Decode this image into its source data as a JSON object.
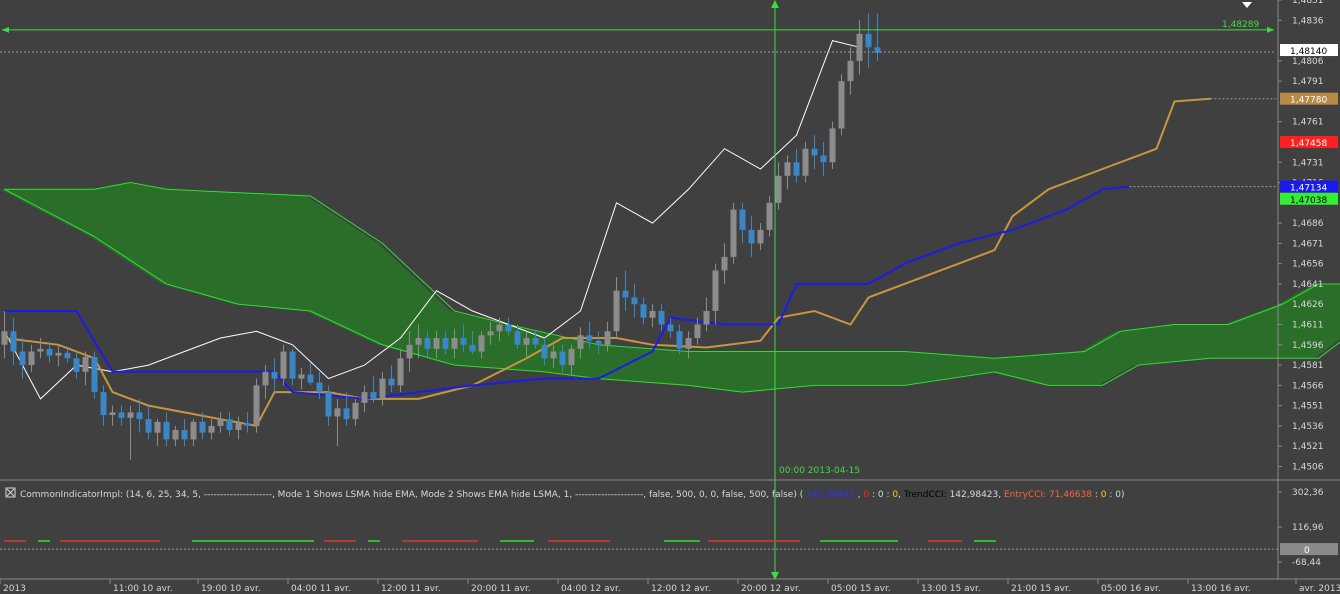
{
  "colors": {
    "background": "#404040",
    "axis_text": "#d8d8d8",
    "bull_candle": "#8c8c8c",
    "bear_candle": "#3a86c6",
    "tenkan": "#c8963e",
    "kijun": "#1b1bea",
    "chikou": "#ffffff",
    "cloud_bear_fill": "#6e2a26",
    "cloud_bear_edge": "#d23a2f",
    "cloud_bull_fill": "#2a6e2a",
    "cloud_bull_edge": "#2ee02e",
    "crosshair": "#3ddc3d",
    "separator": "#8a8a8a"
  },
  "chart_data": {
    "type": "candlestick",
    "title": "",
    "ylim": [
      1.4496,
      1.4851
    ],
    "y_ticks": [
      "1,4851",
      "1,4836",
      "1,4806",
      "1,4791",
      "1,4761",
      "1,4731",
      "1,4716",
      "1,4686",
      "1,4671",
      "1,4656",
      "1,4641",
      "1,4626",
      "1,4611",
      "1,4596",
      "1,4581",
      "1,4566",
      "1,4551",
      "1,4536",
      "1,4521",
      "1,4506"
    ],
    "x_tick_labels": [
      "2013",
      "11:00 10 avr.",
      "19:00 10 avr.",
      "04:00 11 avr.",
      "12:00 11 avr.",
      "20:00 11 avr.",
      "04:00 12 avr.",
      "12:00 12 avr.",
      "20:00 12 avr.",
      "05:00 15 avr.",
      "13:00 15 avr.",
      "21:00 15 avr.",
      "05:00 16 avr.",
      "13:00 16 avr.",
      "avr. 2013"
    ],
    "n_slots": 142,
    "candles": [
      [
        1.4596,
        1.4621,
        1.4586,
        1.4606
      ],
      [
        1.4606,
        1.4616,
        1.4581,
        1.4591
      ],
      [
        1.4591,
        1.4601,
        1.4571,
        1.4581
      ],
      [
        1.4581,
        1.4596,
        1.4576,
        1.4591
      ],
      [
        1.4591,
        1.4601,
        1.4586,
        1.4593
      ],
      [
        1.4593,
        1.4598,
        1.4583,
        1.4588
      ],
      [
        1.4588,
        1.4596,
        1.458,
        1.459
      ],
      [
        1.459,
        1.4593,
        1.4583,
        1.4586
      ],
      [
        1.4586,
        1.4591,
        1.4571,
        1.4576
      ],
      [
        1.4576,
        1.4591,
        1.4566,
        1.4587
      ],
      [
        1.4587,
        1.4591,
        1.4556,
        1.4561
      ],
      [
        1.4561,
        1.4566,
        1.4536,
        1.4544
      ],
      [
        1.4544,
        1.4551,
        1.4536,
        1.4546
      ],
      [
        1.4546,
        1.4551,
        1.4536,
        1.4542
      ],
      [
        1.4542,
        1.4551,
        1.4511,
        1.4546
      ],
      [
        1.4546,
        1.4556,
        1.4531,
        1.4541
      ],
      [
        1.4541,
        1.4551,
        1.4526,
        1.4531
      ],
      [
        1.4531,
        1.4541,
        1.4521,
        1.4539
      ],
      [
        1.4539,
        1.4546,
        1.4521,
        1.4526
      ],
      [
        1.4526,
        1.4536,
        1.4521,
        1.4533
      ],
      [
        1.4533,
        1.4541,
        1.4521,
        1.4526
      ],
      [
        1.4526,
        1.4541,
        1.4521,
        1.4539
      ],
      [
        1.4539,
        1.4546,
        1.4526,
        1.4531
      ],
      [
        1.4531,
        1.4541,
        1.4526,
        1.4536
      ],
      [
        1.4536,
        1.4546,
        1.4531,
        1.4541
      ],
      [
        1.4541,
        1.4546,
        1.4529,
        1.4533
      ],
      [
        1.4533,
        1.4543,
        1.4526,
        1.4538
      ],
      [
        1.4538,
        1.4546,
        1.4531,
        1.4536
      ],
      [
        1.4536,
        1.4571,
        1.4531,
        1.4566
      ],
      [
        1.4566,
        1.4581,
        1.4556,
        1.4576
      ],
      [
        1.4576,
        1.4586,
        1.4561,
        1.4571
      ],
      [
        1.4571,
        1.4596,
        1.4566,
        1.4591
      ],
      [
        1.4591,
        1.4593,
        1.4566,
        1.4571
      ],
      [
        1.4571,
        1.4579,
        1.4563,
        1.4574
      ],
      [
        1.4574,
        1.4583,
        1.4566,
        1.4568
      ],
      [
        1.4568,
        1.4576,
        1.4556,
        1.4561
      ],
      [
        1.4561,
        1.4566,
        1.4536,
        1.4543
      ],
      [
        1.4543,
        1.4556,
        1.4521,
        1.4549
      ],
      [
        1.4549,
        1.4561,
        1.4536,
        1.4541
      ],
      [
        1.4541,
        1.4556,
        1.4536,
        1.4553
      ],
      [
        1.4553,
        1.4566,
        1.4546,
        1.4561
      ],
      [
        1.4561,
        1.4573,
        1.4553,
        1.4556
      ],
      [
        1.4556,
        1.4576,
        1.4551,
        1.4571
      ],
      [
        1.4571,
        1.4581,
        1.4561,
        1.4566
      ],
      [
        1.4566,
        1.4593,
        1.4561,
        1.4586
      ],
      [
        1.4586,
        1.4606,
        1.4576,
        1.4596
      ],
      [
        1.4596,
        1.4611,
        1.4586,
        1.4601
      ],
      [
        1.4601,
        1.4606,
        1.4586,
        1.4593
      ],
      [
        1.4593,
        1.4606,
        1.4586,
        1.4601
      ],
      [
        1.4601,
        1.4606,
        1.4589,
        1.4593
      ],
      [
        1.4593,
        1.4608,
        1.4586,
        1.4601
      ],
      [
        1.4601,
        1.4611,
        1.4591,
        1.4596
      ],
      [
        1.4596,
        1.4606,
        1.4589,
        1.4591
      ],
      [
        1.4591,
        1.4606,
        1.4586,
        1.4603
      ],
      [
        1.4603,
        1.4613,
        1.4596,
        1.4606
      ],
      [
        1.4606,
        1.4616,
        1.4599,
        1.4611
      ],
      [
        1.4611,
        1.4616,
        1.4603,
        1.4606
      ],
      [
        1.4606,
        1.4611,
        1.4593,
        1.4596
      ],
      [
        1.4596,
        1.4606,
        1.4586,
        1.4601
      ],
      [
        1.4601,
        1.4606,
        1.4593,
        1.4596
      ],
      [
        1.4596,
        1.4601,
        1.4581,
        1.4586
      ],
      [
        1.4586,
        1.4596,
        1.4579,
        1.4591
      ],
      [
        1.4591,
        1.4596,
        1.4576,
        1.4581
      ],
      [
        1.4581,
        1.4596,
        1.4573,
        1.4593
      ],
      [
        1.4593,
        1.4609,
        1.4586,
        1.4603
      ],
      [
        1.4603,
        1.4613,
        1.4593,
        1.4599
      ],
      [
        1.4599,
        1.4606,
        1.4589,
        1.4596
      ],
      [
        1.4596,
        1.4613,
        1.4591,
        1.4606
      ],
      [
        1.4606,
        1.4646,
        1.4601,
        1.4636
      ],
      [
        1.4636,
        1.4651,
        1.4621,
        1.4631
      ],
      [
        1.4631,
        1.4641,
        1.4616,
        1.4626
      ],
      [
        1.4626,
        1.4631,
        1.4611,
        1.4616
      ],
      [
        1.4616,
        1.4626,
        1.4609,
        1.4621
      ],
      [
        1.4621,
        1.4626,
        1.4606,
        1.4611
      ],
      [
        1.4611,
        1.4616,
        1.4601,
        1.4606
      ],
      [
        1.4606,
        1.4611,
        1.4589,
        1.4593
      ],
      [
        1.4593,
        1.4606,
        1.4586,
        1.4601
      ],
      [
        1.4601,
        1.4616,
        1.4596,
        1.4611
      ],
      [
        1.4611,
        1.4631,
        1.4606,
        1.4621
      ],
      [
        1.4621,
        1.4656,
        1.4611,
        1.4651
      ],
      [
        1.4651,
        1.4671,
        1.4641,
        1.4661
      ],
      [
        1.4661,
        1.4701,
        1.4656,
        1.4696
      ],
      [
        1.4696,
        1.4701,
        1.4671,
        1.4681
      ],
      [
        1.4681,
        1.4691,
        1.4661,
        1.4671
      ],
      [
        1.4671,
        1.4686,
        1.4666,
        1.4681
      ],
      [
        1.4681,
        1.4706,
        1.4676,
        1.4701
      ],
      [
        1.4701,
        1.4731,
        1.4696,
        1.4721
      ],
      [
        1.4721,
        1.4736,
        1.4711,
        1.4731
      ],
      [
        1.4731,
        1.4741,
        1.4716,
        1.4721
      ],
      [
        1.4721,
        1.4746,
        1.4716,
        1.4741
      ],
      [
        1.4741,
        1.4751,
        1.4726,
        1.4736
      ],
      [
        1.4736,
        1.4746,
        1.4721,
        1.4731
      ],
      [
        1.4731,
        1.4761,
        1.4726,
        1.4756
      ],
      [
        1.4756,
        1.4796,
        1.4751,
        1.4791
      ],
      [
        1.4791,
        1.4816,
        1.4781,
        1.4806
      ],
      [
        1.4806,
        1.4836,
        1.4796,
        1.4826
      ],
      [
        1.4826,
        1.4841,
        1.4801,
        1.4816
      ],
      [
        1.4816,
        1.4841,
        1.4806,
        1.4812
      ]
    ],
    "tenkan_sen": [
      [
        0,
        1.4601
      ],
      [
        6,
        1.4596
      ],
      [
        10,
        1.4586
      ],
      [
        12,
        1.4561
      ],
      [
        16,
        1.4551
      ],
      [
        20,
        1.4546
      ],
      [
        24,
        1.4541
      ],
      [
        28,
        1.4536
      ],
      [
        30,
        1.4561
      ],
      [
        36,
        1.4561
      ],
      [
        40,
        1.4556
      ],
      [
        46,
        1.4556
      ],
      [
        52,
        1.4566
      ],
      [
        58,
        1.4586
      ],
      [
        62,
        1.4601
      ],
      [
        68,
        1.4601
      ],
      [
        72,
        1.4596
      ],
      [
        78,
        1.4594
      ],
      [
        84,
        1.4599
      ],
      [
        86,
        1.4616
      ],
      [
        90,
        1.4621
      ],
      [
        94,
        1.4611
      ],
      [
        96,
        1.4631
      ],
      [
        100,
        1.4641
      ],
      [
        106,
        1.4656
      ],
      [
        110,
        1.4666
      ],
      [
        112,
        1.4691
      ],
      [
        116,
        1.4711
      ],
      [
        122,
        1.4726
      ],
      [
        128,
        1.4741
      ],
      [
        130,
        1.4776
      ],
      [
        134,
        1.4778
      ]
    ],
    "kijun_sen": [
      [
        0,
        1.4621
      ],
      [
        8,
        1.4621
      ],
      [
        12,
        1.4576
      ],
      [
        30,
        1.4576
      ],
      [
        32,
        1.4561
      ],
      [
        40,
        1.4556
      ],
      [
        46,
        1.4561
      ],
      [
        52,
        1.4566
      ],
      [
        60,
        1.4571
      ],
      [
        66,
        1.4571
      ],
      [
        72,
        1.4591
      ],
      [
        74,
        1.4616
      ],
      [
        80,
        1.4611
      ],
      [
        86,
        1.4611
      ],
      [
        88,
        1.4641
      ],
      [
        96,
        1.4641
      ],
      [
        100,
        1.4656
      ],
      [
        106,
        1.4671
      ],
      [
        112,
        1.4681
      ],
      [
        118,
        1.4696
      ],
      [
        122,
        1.4711
      ],
      [
        125,
        1.4713
      ]
    ],
    "chikou_span": [
      [
        0,
        1.4606
      ],
      [
        4,
        1.4556
      ],
      [
        8,
        1.4581
      ],
      [
        12,
        1.4576
      ],
      [
        16,
        1.4581
      ],
      [
        20,
        1.4591
      ],
      [
        24,
        1.4601
      ],
      [
        28,
        1.4606
      ],
      [
        32,
        1.4596
      ],
      [
        36,
        1.4571
      ],
      [
        40,
        1.4581
      ],
      [
        44,
        1.4601
      ],
      [
        48,
        1.4636
      ],
      [
        52,
        1.4621
      ],
      [
        56,
        1.4611
      ],
      [
        60,
        1.4601
      ],
      [
        64,
        1.4621
      ],
      [
        68,
        1.4701
      ],
      [
        72,
        1.4686
      ],
      [
        76,
        1.4711
      ],
      [
        80,
        1.4741
      ],
      [
        84,
        1.4726
      ],
      [
        88,
        1.4751
      ],
      [
        92,
        1.4821
      ],
      [
        95,
        1.4816
      ]
    ],
    "senkou_span_a": [
      [
        0,
        1.4711
      ],
      [
        10,
        1.4711
      ],
      [
        14,
        1.4716
      ],
      [
        18,
        1.4711
      ],
      [
        34,
        1.4706
      ],
      [
        42,
        1.4671
      ],
      [
        50,
        1.4621
      ],
      [
        56,
        1.4611
      ],
      [
        66,
        1.4596
      ],
      [
        76,
        1.4591
      ],
      [
        82,
        1.4591
      ],
      [
        100,
        1.4591
      ],
      [
        110,
        1.4586
      ],
      [
        120,
        1.4591
      ],
      [
        124,
        1.4606
      ],
      [
        130,
        1.4611
      ],
      [
        136,
        1.4611
      ],
      [
        142,
        1.4626
      ],
      [
        146,
        1.4641
      ],
      [
        152,
        1.4641
      ],
      [
        156,
        1.4666
      ],
      [
        160,
        1.4681
      ],
      [
        164,
        1.4696
      ],
      [
        168,
        1.4721
      ],
      [
        170,
        1.4741
      ]
    ],
    "senkou_span_b": [
      [
        0,
        1.4711
      ],
      [
        10,
        1.4676
      ],
      [
        18,
        1.4641
      ],
      [
        26,
        1.4626
      ],
      [
        34,
        1.4621
      ],
      [
        42,
        1.4596
      ],
      [
        50,
        1.4581
      ],
      [
        60,
        1.4576
      ],
      [
        66,
        1.4571
      ],
      [
        76,
        1.4566
      ],
      [
        82,
        1.4561
      ],
      [
        90,
        1.4566
      ],
      [
        100,
        1.4566
      ],
      [
        110,
        1.4576
      ],
      [
        116,
        1.4566
      ],
      [
        122,
        1.4566
      ],
      [
        126,
        1.4581
      ],
      [
        134,
        1.4586
      ],
      [
        140,
        1.4586
      ],
      [
        146,
        1.4586
      ],
      [
        150,
        1.4606
      ],
      [
        160,
        1.4626
      ],
      [
        166,
        1.4636
      ],
      [
        170,
        1.4706
      ]
    ],
    "price_labels": [
      {
        "text": "1,48140",
        "bg": "#ffffff",
        "fg": "#000000",
        "value": 1.4814
      },
      {
        "text": "1,47780",
        "bg": "#b78a45",
        "fg": "#ffffff",
        "value": 1.4778
      },
      {
        "text": "1,47458",
        "bg": "#ff2020",
        "fg": "#ffffff",
        "value": 1.4746
      },
      {
        "text": "1,47134",
        "bg": "#1a1aee",
        "fg": "#ffffff",
        "value": 1.4713
      },
      {
        "text": "1,47038",
        "bg": "#33ee33",
        "fg": "#000000",
        "value": 1.4704
      }
    ],
    "horizontal_line": {
      "value": 1.48289,
      "text": "1,48289"
    },
    "crosshair": {
      "time_label": "00:00 2013-04-15"
    },
    "indicator": {
      "title": "CommonIndicatorImpl: (14, 6, 25, 34, 5, ---------------------, Mode 1 Shows LSMA hide EMA, Mode 2 Shows EMA hide LSMA, 1, ---------------------, false, 500, 0, 0, false, 500, false)",
      "v1": "142,98423",
      "v2": "0",
      "v3": "0",
      "v4": "0",
      "trend_label": "TrendCCI:",
      "trend_value": "142,98423",
      "entry_label": "EntryCCI:",
      "entry_value": "71,46638",
      "v5": "0",
      "v6": "0",
      "ylim": [
        -68.44,
        302.36
      ],
      "y_ticks": [
        "302,36",
        "116,96",
        "-68,44"
      ],
      "zero_label": "0"
    }
  }
}
